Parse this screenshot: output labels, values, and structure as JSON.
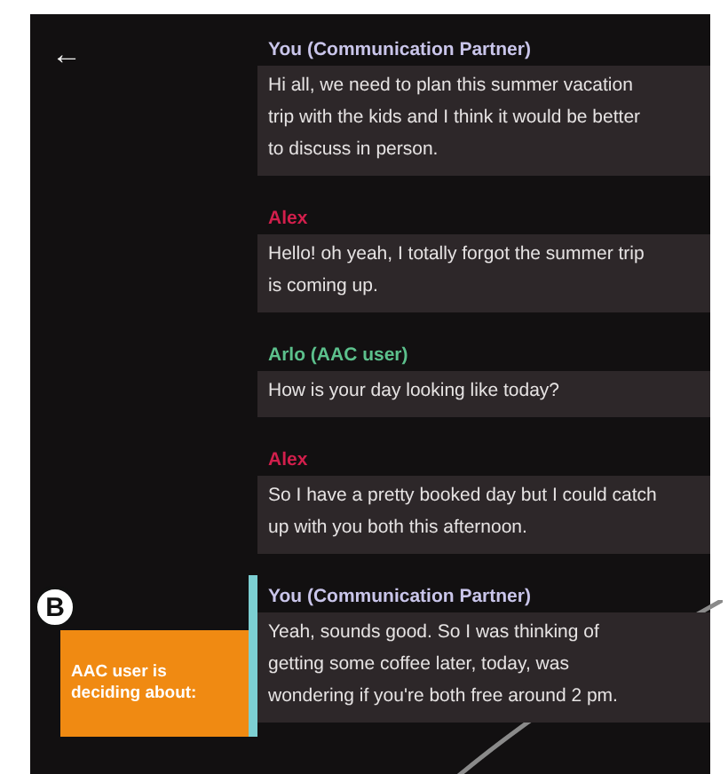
{
  "back_label": "←",
  "messages": [
    {
      "speaker": "You (Communication Partner)",
      "color": "#c9c5ea",
      "text": "Hi all, we need to plan this summer vacation trip with the kids and I think it would be better to discuss in person.",
      "highlighted": false
    },
    {
      "speaker": "Alex",
      "color": "#d21f4c",
      "text": "Hello! oh yeah, I totally forgot the summer trip is coming up.",
      "highlighted": false
    },
    {
      "speaker": "Arlo (AAC user)",
      "color": "#5cc08c",
      "text": "How is your day looking like today?",
      "highlighted": false
    },
    {
      "speaker": "Alex",
      "color": "#d21f4c",
      "text": "So I have a pretty booked day but I could catch up with you both this afternoon.",
      "highlighted": false
    },
    {
      "speaker": "You (Communication Partner)",
      "color": "#c9c5ea",
      "text": "Yeah, sounds good. So I was thinking of getting some coffee later, today, was wondering if you're both free around 2 pm.",
      "highlighted": true
    }
  ],
  "annotation": {
    "badge": "B",
    "label": "AAC user is deciding about:"
  }
}
